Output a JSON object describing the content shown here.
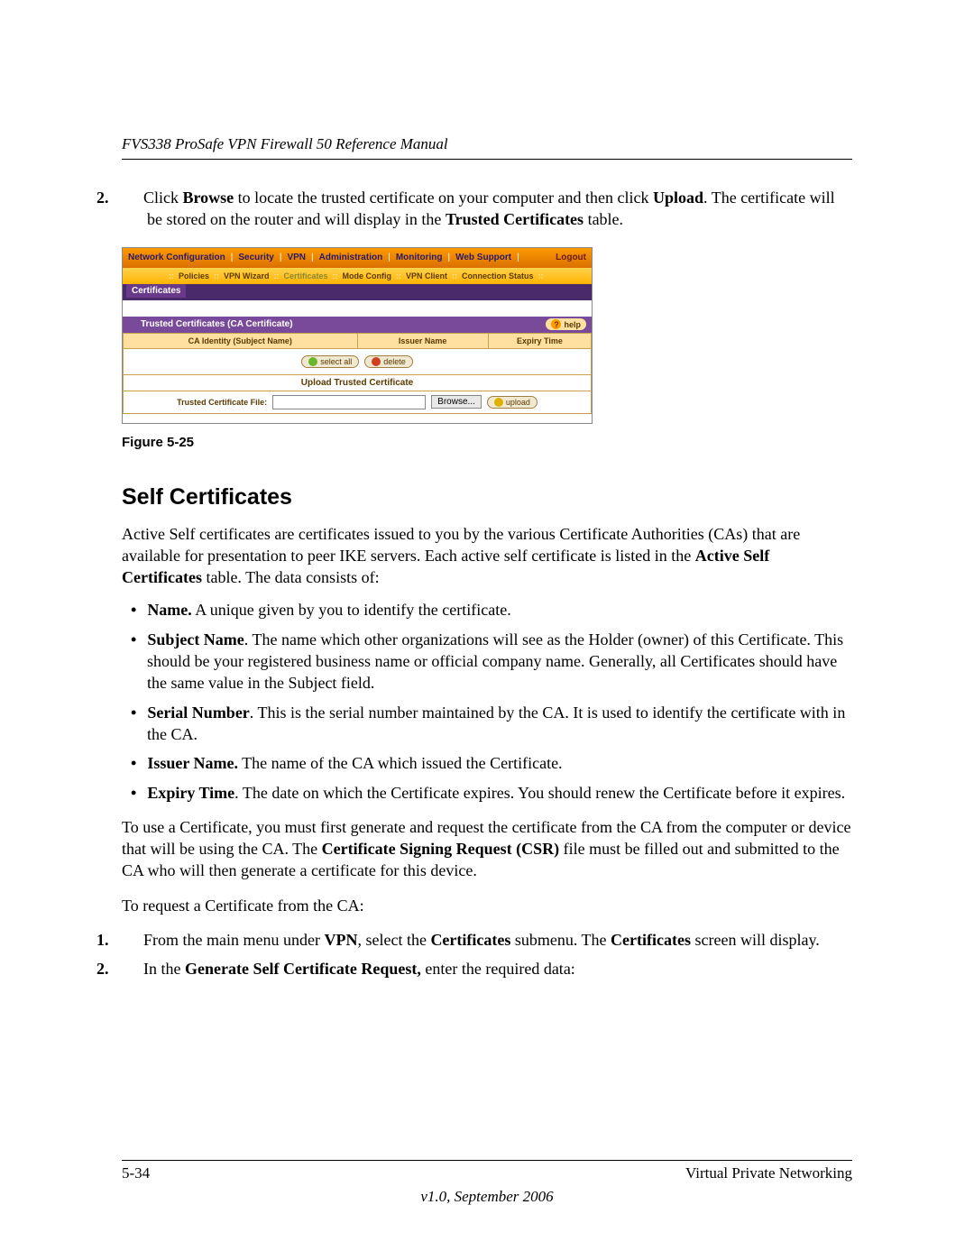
{
  "header": {
    "manual_title": "FVS338 ProSafe VPN Firewall 50 Reference Manual"
  },
  "intro": {
    "step_num": "2.",
    "pre1": "Click ",
    "b1": "Browse",
    "mid1": " to locate the trusted certificate on your computer and then click ",
    "b2": "Upload",
    "mid2": ". The certificate will be stored on the router and will display in the ",
    "b3": "Trusted Certificates",
    "post": " table."
  },
  "shot": {
    "nav1": {
      "netconf": "Network Configuration",
      "security": "Security",
      "vpn": "VPN",
      "admin": "Administration",
      "monitoring": "Monitoring",
      "websupport": "Web Support",
      "logout": "Logout"
    },
    "nav2": {
      "policies": "Policies",
      "vpnwizard": "VPN Wizard",
      "certificates": "Certificates",
      "modeconfig": "Mode Config",
      "vpnclient": "VPN Client",
      "connstatus": "Connection Status"
    },
    "tab": "Certificates",
    "section_title": "Trusted Certificates (CA Certificate)",
    "help": "help",
    "cols": {
      "ca_identity": "CA Identity (Subject Name)",
      "issuer": "Issuer Name",
      "expiry": "Expiry Time"
    },
    "btn_selectall": "select all",
    "btn_delete": "delete",
    "upload_head": "Upload Trusted Certificate",
    "file_label": "Trusted Certificate File:",
    "browse": "Browse...",
    "upload": "upload"
  },
  "figure_caption": "Figure 5-25",
  "section_heading": "Self Certificates",
  "para1": {
    "pre": "Active Self certificates are certificates issued to you by the various Certificate Authorities (CAs) that are available for presentation to peer IKE servers. Each active self certificate is listed in the ",
    "b": "Active Self Certificates",
    "post": " table. The data consists of:"
  },
  "bullets": {
    "name_b": "Name.",
    "name_t": " A unique given by you to identify the certificate.",
    "subj_b": "Subject Name",
    "subj_t": ". The name which other organizations will see as the Holder (owner) of this Certificate. This should be your registered business name or official company name. Generally, all Certificates should have the same value in the Subject field.",
    "ser_b": "Serial Number",
    "ser_t": ". This is the serial number maintained by the CA. It is used to identify the certificate with in the CA.",
    "iss_b": "Issuer Name.",
    "iss_t": " The name of the CA which issued the Certificate.",
    "exp_b": "Expiry Time",
    "exp_t": ". The date on which the Certificate expires. You should renew the Certificate before it expires."
  },
  "para2": {
    "pre": "To use a Certificate, you must first generate and request the certificate from the CA from the computer or device that will be using the CA. The ",
    "b": "Certificate Signing Request (CSR)",
    "post": " file must be filled out and submitted to the CA who will then generate a certificate for this device."
  },
  "para3": "To request a Certificate from the CA:",
  "steps": {
    "s1": {
      "n": "1.",
      "pre": "From the main menu under ",
      "b1": "VPN",
      "mid1": ", select the ",
      "b2": "Certificates",
      "mid2": " submenu. The ",
      "b3": "Certificates",
      "post": " screen will display."
    },
    "s2": {
      "n": "2.",
      "pre": "In the ",
      "b1": "Generate Self Certificate Request,",
      "post": " enter the required data:"
    }
  },
  "footer": {
    "page": "5-34",
    "section": "Virtual Private Networking",
    "version": "v1.0, September 2006"
  }
}
